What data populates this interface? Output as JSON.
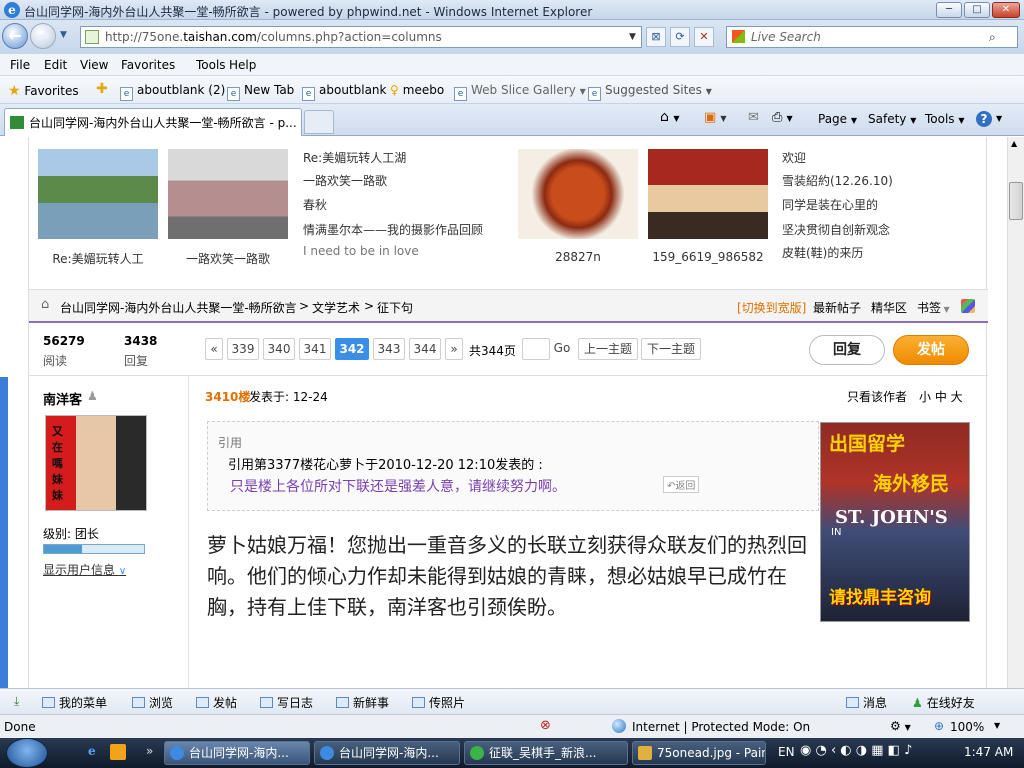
{
  "window": {
    "title": "台山同学网-海内外台山人共聚一堂-畅所欲言 - powered by phpwind.net - Windows Internet Explorer",
    "buttons": {
      "minimize": "─",
      "maximize": "□",
      "close": "✕"
    }
  },
  "addressbar": {
    "url_prefix": "http://75one.",
    "url_domain": "taishan.com",
    "url_path": "/columns.php?action=columns",
    "search_placeholder": "Live Search"
  },
  "menu": [
    "File",
    "Edit",
    "View",
    "Favorites",
    "Tools",
    "Help"
  ],
  "favorites_bar": {
    "favorites": "Favorites",
    "items": [
      "aboutblank (2)",
      "New Tab",
      "aboutblank",
      "meebo",
      "Web Slice Gallery",
      "Suggested Sites"
    ]
  },
  "tab": {
    "label": "台山同学网-海内外台山人共聚一堂-畅所欲言 - p..."
  },
  "command_bar": {
    "page": "Page",
    "safety": "Safety",
    "tools": "Tools"
  },
  "gallery": {
    "captions": [
      "Re:美媚玩转人工",
      "一路欢笑一路歌",
      "28827n",
      "159_6619_986582"
    ],
    "links_left": [
      "Re:美媚玩转人工湖",
      "一路欢笑一路歌",
      "春秋",
      "情满墨尔本——我的摄影作品回顾",
      "I need to be in love"
    ],
    "links_right": [
      "欢迎",
      "雪装紹約(12.26.10)",
      "同学是装在心里的",
      "坚决贯彻自创新观念",
      "皮鞋(鞋)的来历"
    ]
  },
  "breadcrumb": {
    "site": "台山同学网-海内外台山人共聚一堂-畅所欲言",
    "sep": ">",
    "section": "文学艺术",
    "current": "征下句",
    "switch_width": "[切换到宽版]",
    "newest": "最新帖子",
    "digest": "精华区",
    "bookmark": "书签"
  },
  "stats": {
    "views": "56279",
    "views_label": "阅读",
    "replies": "3438",
    "replies_label": "回复"
  },
  "pagination": {
    "prev": "«",
    "pages": [
      "339",
      "340",
      "341",
      "342",
      "343",
      "344"
    ],
    "current": "342",
    "next": "»",
    "total": "共344页",
    "go": "Go",
    "prev_topic": "上一主题",
    "next_topic": "下一主题"
  },
  "actions": {
    "reply": "回复",
    "post": "发帖"
  },
  "author": {
    "name": "南洋客",
    "avatar_text": "又在嗎妹妹",
    "level": "级别: 团长",
    "show_info": "显示用户信息"
  },
  "post": {
    "floor": "3410楼",
    "posted": "发表于: 12-24",
    "only_author": "只看该作者",
    "font_sizes": "小 中 大",
    "quote_label": "引用",
    "quote_header": "引用第3377楼花心萝卜于2010-12-20 12:10发表的 :",
    "quote_text": "只是楼上各位所对下联还是强差人意，请继续努力啊。",
    "quote_back": "返回",
    "body": "萝卜姑娘万福！您抛出一重音多义的长联立刻获得众联友们的热烈回响。他们的倾心力作却未能得到姑娘的青睐，想必姑娘早已成竹在胸，持有上佳下联，南洋客也引颈俟盼。"
  },
  "ad": {
    "line1": "出国留学",
    "line2": "海外移民",
    "school": "ST. JOHN'S",
    "partial": "IN",
    "cta": "请找鼎丰咨询"
  },
  "bbs_toolbar": {
    "items": [
      "我的菜单",
      "浏览",
      "发帖",
      "写日志",
      "新鲜事",
      "传照片"
    ],
    "messages": "消息",
    "online": "在线好友"
  },
  "statusbar": {
    "left": "Done",
    "zone": "Internet | Protected Mode: On",
    "zoom": "100%"
  },
  "taskbar": {
    "tasks": [
      "台山同学网-海内...",
      "台山同学网-海内...",
      "征联_吴棋手_新浪...",
      "75onead.jpg - Paint"
    ],
    "lang": "EN",
    "time": "1:47 AM"
  },
  "colors": {
    "accent_purple": "#8c6fbb",
    "floor_orange": "#e07000",
    "post_button": "#f39800",
    "pagination_current": "#3a8ee6"
  }
}
